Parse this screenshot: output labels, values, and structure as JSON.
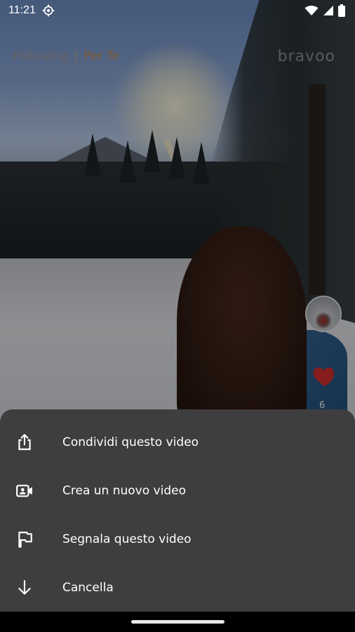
{
  "status_bar": {
    "time": "11:21"
  },
  "top_tabs": {
    "following": "Following",
    "separator": "|",
    "for_you": "Per Te"
  },
  "brand": {
    "logo_text": "bravoo"
  },
  "video_actions": {
    "like_count": "6"
  },
  "sheet": {
    "items": [
      {
        "label": "Condividi questo video",
        "icon": "share-icon"
      },
      {
        "label": "Crea un nuovo video",
        "icon": "video-camera-icon"
      },
      {
        "label": "Segnala questo video",
        "icon": "flag-icon"
      },
      {
        "label": "Cancella",
        "icon": "arrow-down-icon"
      }
    ]
  },
  "colors": {
    "sheet_background": "#3e3e3e",
    "accent_orange": "#d88f3c",
    "heart_red": "#d9302e"
  }
}
